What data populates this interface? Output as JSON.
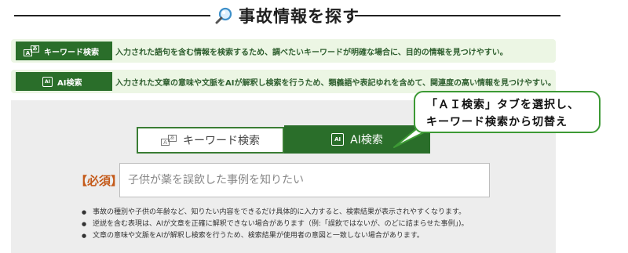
{
  "header": {
    "title": "事故情報を探す",
    "icon": "search-icon"
  },
  "info_rows": [
    {
      "label": "キーワード検索",
      "icon": "keyword-icon",
      "description": "入力された語句を含む情報を検索するため、調べたいキーワードが明確な場合に、目的の情報を見つけやすい。"
    },
    {
      "label": "AI検索",
      "icon": "ai-chip-icon",
      "description": "入力された文章の意味や文脈をAIが解釈し検索を行うため、類義語や表記ゆれを含めて、関連度の高い情報を見つけやすい。"
    }
  ],
  "tabs": {
    "keyword_label": "キーワード検索",
    "ai_label": "AI検索",
    "active": "ai"
  },
  "callout": {
    "line1": "「ＡＩ検索」タブを選択し、",
    "line2": "キーワード検索から切替え"
  },
  "search": {
    "required_label": "【必須】",
    "placeholder": "子供が薬を誤飲した事例を知りたい",
    "value": ""
  },
  "notes": [
    "事故の種別や子供の年齢など、知りたい内容をできるだけ具体的に入力すると、検索結果が表示されやすくなります。",
    "逆説を含む表現は、AIが文章を正確に解釈できない場合があります（例:「誤飲ではないが、のどに詰まらせた事例」)。",
    "文章の意味や文脈をAIが解釈し検索を行うため、検索結果が使用者の意図と一致しない場合があります。"
  ],
  "colors": {
    "brand_green": "#2a6e2a",
    "row_bg": "#ecf6e4",
    "callout_border": "#3d9a35",
    "required": "#c45a1a",
    "panel": "#ededed"
  }
}
